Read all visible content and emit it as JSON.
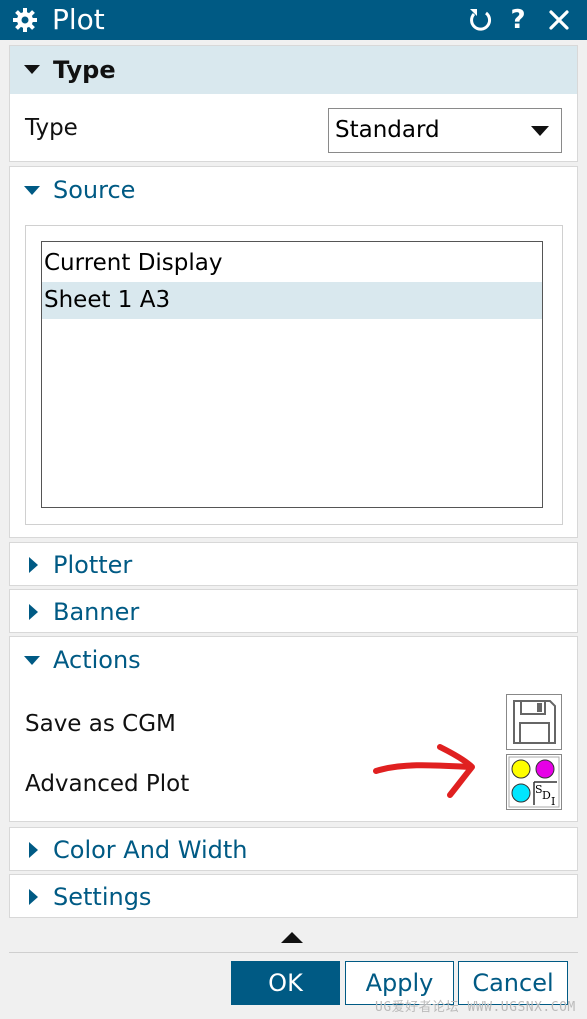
{
  "window": {
    "title": "Plot",
    "help_label": "?"
  },
  "sections": {
    "type": {
      "label": "Type",
      "field_label": "Type",
      "selected_value": "Standard"
    },
    "source": {
      "label": "Source",
      "items": [
        "Current Display",
        "Sheet 1  A3"
      ],
      "selected_index": 1
    },
    "plotter": {
      "label": "Plotter"
    },
    "banner": {
      "label": "Banner"
    },
    "actions": {
      "label": "Actions",
      "save_cgm_label": "Save as CGM",
      "advanced_plot_label": "Advanced Plot"
    },
    "color_width": {
      "label": "Color And Width"
    },
    "settings": {
      "label": "Settings"
    }
  },
  "buttons": {
    "ok": "OK",
    "apply": "Apply",
    "cancel": "Cancel"
  },
  "watermark": "UG爱好者论坛 WWW.UGSNX.COM",
  "colors": {
    "accent": "#005a84",
    "selection": "#d9e8ee",
    "annotation_arrow": "#e02020"
  },
  "icons": [
    "gear-icon",
    "reset-icon",
    "help-icon",
    "close-icon",
    "floppy-disk-icon",
    "advanced-plot-icon"
  ]
}
